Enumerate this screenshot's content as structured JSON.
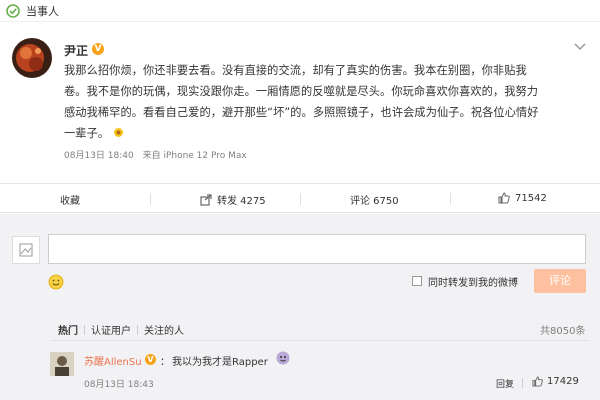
{
  "topbar": {
    "label": "当事人"
  },
  "post": {
    "author": "尹正",
    "verified_badge": "V",
    "lines": [
      "我那么招你烦，你还非要去看。没有直接的交流，却有了真实的伤害。我本在别圈，你非贴我",
      "卷。我不是你的玩偶，现实没跟你走。一厢情愿的反噬就是尽头。你玩命喜欢你喜欢的，我努力",
      "感动我稀罕的。看看自己爱的，避开那些“坏”的。多照照镜子，也许会成为仙子。祝各位心情好",
      "一辈子。"
    ],
    "time": "08月13日 18:40",
    "source": "来自 iPhone 12 Pro Max"
  },
  "actions": {
    "favorite": "收藏",
    "forward": "转发 4275",
    "comment": "评论 6750",
    "like": "71542"
  },
  "comment_box": {
    "my_avatar_text": "头像",
    "input_placeholder": "",
    "forward_checkbox_label": "同时转发到我的微博",
    "submit_label": "评论"
  },
  "comment_tabs": {
    "tabs": [
      "热门",
      "认证用户",
      "关注的人"
    ],
    "total": "共8050条"
  },
  "comment": {
    "name": "苏醒AllenSu",
    "badge": "V",
    "colon": "：",
    "text": "我以为我才是Rapper",
    "time": "08月13日 18:43",
    "reply": "回复",
    "likes": "17429"
  },
  "colors": {
    "accent_orange": "#eb7350",
    "badge_gold": "#f7a31b",
    "submit_disabled": "#ffc09f",
    "comment_bg": "#f2f2f5"
  }
}
